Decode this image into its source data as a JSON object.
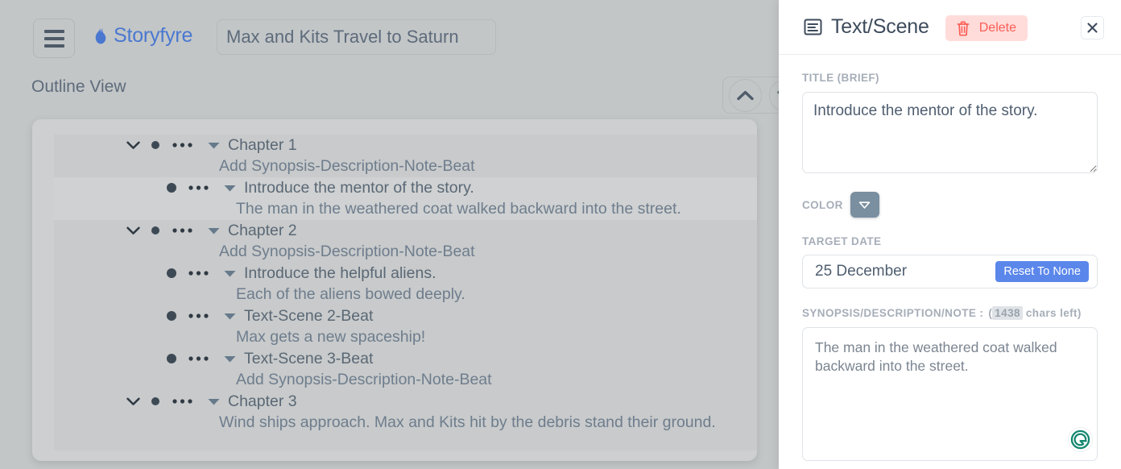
{
  "topbar": {
    "menu_icon": "hamburger-menu-icon",
    "brand_icon": "flame-icon",
    "brand_name": "Storyfyre",
    "brand_color": "#4a78d0",
    "project_title_value": "Max and Kits Travel to Saturn",
    "project_title_placeholder": "Project Title"
  },
  "outline": {
    "view_title": "Outline View",
    "collapse_all_icon": "chevron-up-icon",
    "expand_all_icon": "chevron-down-icon",
    "rows": [
      {
        "type": "chapter",
        "label": "Chapter 1",
        "sub": "Add Synopsis-Description-Note-Beat",
        "selected": false,
        "sub_indent": 205,
        "icons_indent": 84
      },
      {
        "type": "scene",
        "label": "Introduce the mentor of the story.",
        "sub": "The man in the weathered coat walked backward into the street.",
        "selected": true,
        "sub_indent": 226,
        "icons_indent": 132
      },
      {
        "type": "chapter",
        "label": "Chapter 2",
        "sub": "Add Synopsis-Description-Note-Beat",
        "selected": false,
        "sub_indent": 205,
        "icons_indent": 84
      },
      {
        "type": "scene",
        "label": "Introduce the helpful aliens.",
        "sub": "Each of the aliens bowed deeply.",
        "selected": false,
        "sub_indent": 226,
        "icons_indent": 132
      },
      {
        "type": "scene",
        "label": "Text-Scene 2-Beat",
        "sub": "Max gets a new spaceship!",
        "selected": false,
        "sub_indent": 226,
        "icons_indent": 132
      },
      {
        "type": "scene",
        "label": "Text-Scene 3-Beat",
        "sub": "Add Synopsis-Description-Note-Beat",
        "selected": false,
        "sub_indent": 226,
        "icons_indent": 132
      },
      {
        "type": "chapter",
        "label": "Chapter 3",
        "sub": "Wind ships approach. Max and Kits hit by the debris stand their ground.",
        "selected": false,
        "sub_indent": 205,
        "icons_indent": 84
      }
    ]
  },
  "panel": {
    "header_icon": "document-lines-icon",
    "title": "Text/Scene",
    "delete_icon": "trash-icon",
    "delete_label": "Delete",
    "delete_color": "#fc5d55",
    "delete_bg": "#ffdcda",
    "close_icon": "close-icon",
    "title_field": {
      "label": "TITLE (brief)",
      "value": "Introduce the mentor of the story.",
      "placeholder": "Title"
    },
    "color_field": {
      "label": "COLOR",
      "dropdown_icon": "chevron-down-icon",
      "swatch_color": "#7a8fa0"
    },
    "target_date_field": {
      "label": "TARGET DATE",
      "value": "25 December",
      "placeholder": "Target date",
      "reset_label": "Reset To None",
      "reset_color": "#5b87eb"
    },
    "synopsis_field": {
      "label": "SYNOPSIS/DESCRIPTION/NOTE :",
      "chars_left": "1438",
      "chars_suffix": "chars left)",
      "paren_open": "(",
      "value": "The man in the weathered coat walked backward into the street.",
      "placeholder": "Synopsis"
    },
    "grammarly_icon": "grammarly-icon",
    "grammarly_color": "#15876f"
  }
}
